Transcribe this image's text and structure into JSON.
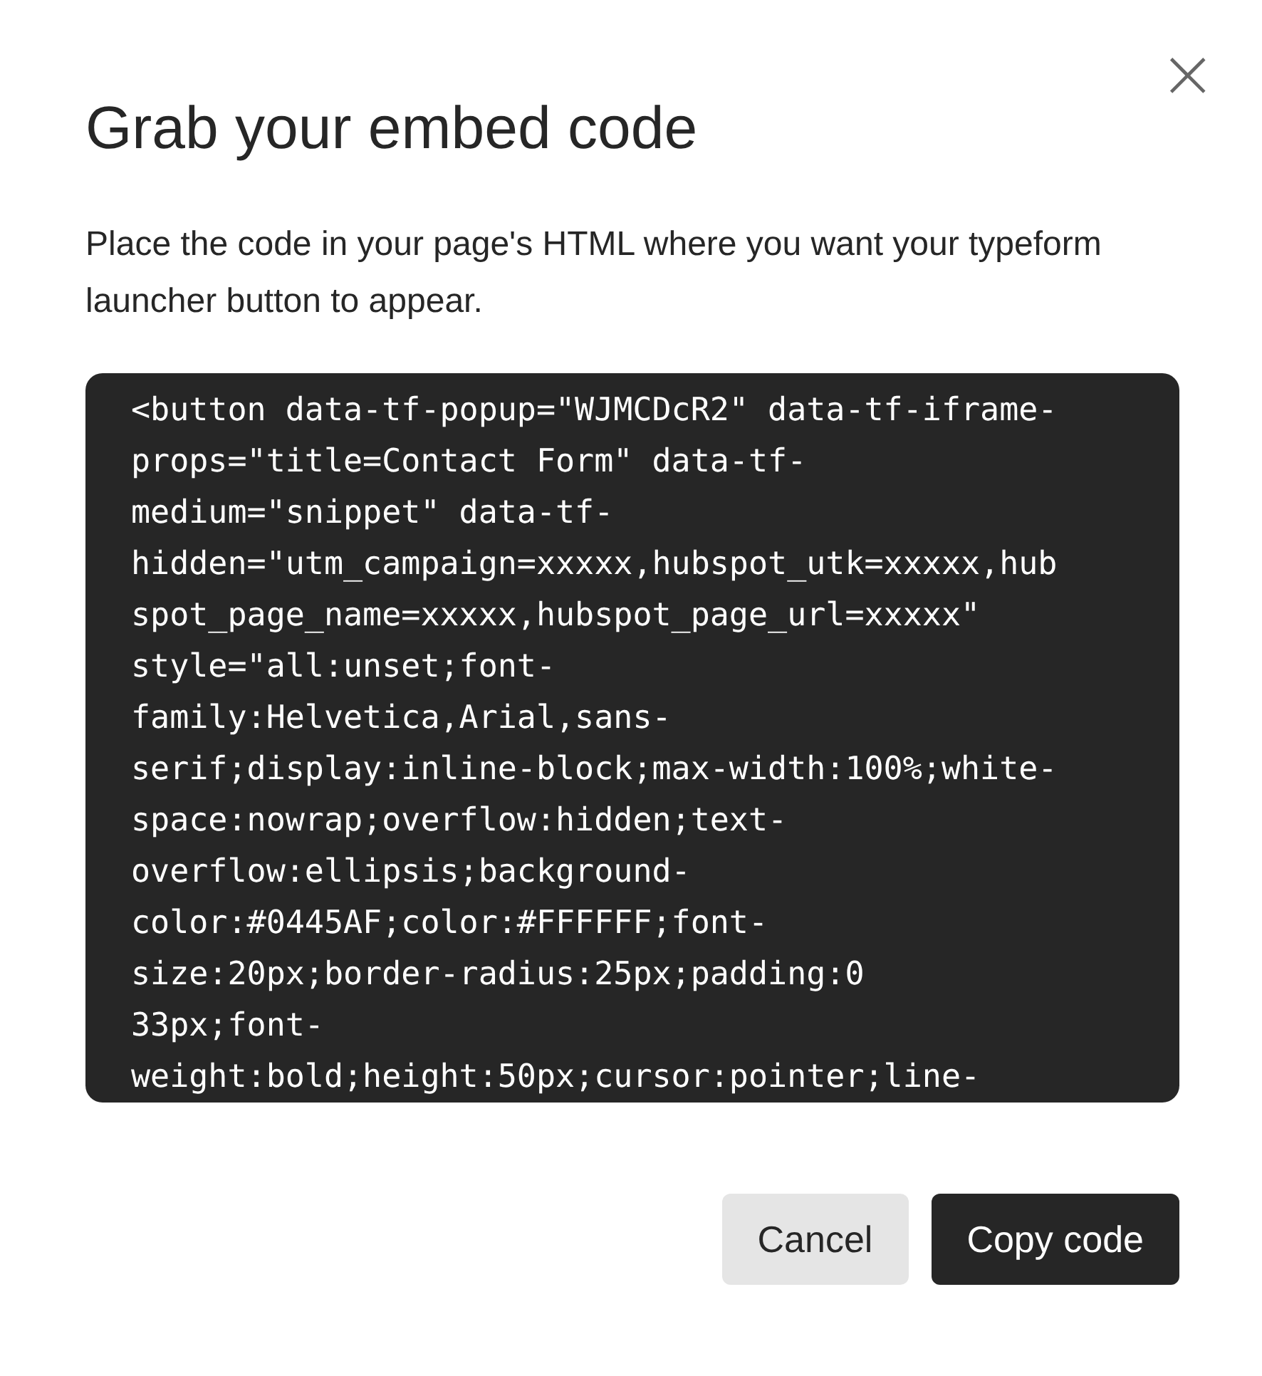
{
  "dialog": {
    "title": "Grab your embed code",
    "close_label": "×",
    "description": "Place the code in your page's HTML where you want your typeform launcher button to appear.",
    "code_lines": [
      "<button data-tf-popup=\"WJMCDcR2\" data-tf-iframe-",
      "props=\"title=Contact Form\" data-tf-",
      "medium=\"snippet\" data-tf-",
      "hidden=\"utm_campaign=xxxxx,hubspot_utk=xxxxx,hub",
      "spot_page_name=xxxxx,hubspot_page_url=xxxxx\"",
      "style=\"all:unset;font-",
      "family:Helvetica,Arial,sans-",
      "serif;display:inline-block;max-width:100%;white-",
      "space:nowrap;overflow:hidden;text-",
      "overflow:ellipsis;background-",
      "color:#0445AF;color:#FFFFFF;font-",
      "size:20px;border-radius:25px;padding:0",
      "33px;font-",
      "weight:bold;height:50px;cursor:pointer;line-"
    ],
    "buttons": [
      {
        "label": "Cancel",
        "kind": "secondary"
      },
      {
        "label": "Copy code",
        "kind": "primary"
      }
    ]
  }
}
